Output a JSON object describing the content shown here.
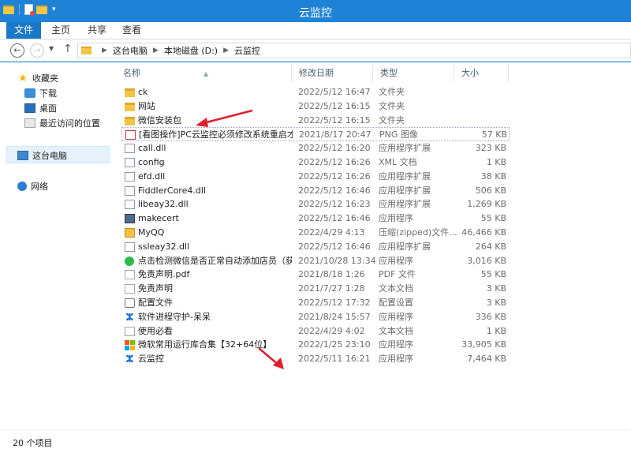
{
  "window": {
    "title": "云监控"
  },
  "ribbon": {
    "tabs": [
      "文件",
      "主页",
      "共享",
      "查看"
    ]
  },
  "address": {
    "crumbs": [
      "这台电脑",
      "本地磁盘 (D:)",
      "云监控"
    ]
  },
  "nav": {
    "favorites": "收藏夹",
    "downloads": "下载",
    "desktop": "桌面",
    "recent": "最近访问的位置",
    "this_pc": "这台电脑",
    "network": "网络"
  },
  "columns": {
    "name": "名称",
    "date": "修改日期",
    "type": "类型",
    "size": "大小"
  },
  "files": [
    {
      "name": "ck",
      "date": "2022/5/12 16:47",
      "type": "文件夹",
      "size": "",
      "icon": "folder-icon"
    },
    {
      "name": "网站",
      "date": "2022/5/12 16:15",
      "type": "文件夹",
      "size": "",
      "icon": "folder-icon"
    },
    {
      "name": "微信安装包",
      "date": "2022/5/12 16:15",
      "type": "文件夹",
      "size": "",
      "icon": "folder-icon"
    },
    {
      "name": "[看图操作]PC云监控必须修改系统重启才...",
      "date": "2021/8/17 20:47",
      "type": "PNG 图像",
      "size": "57 KB",
      "icon": "png-icon"
    },
    {
      "name": "call.dll",
      "date": "2022/5/12 16:20",
      "type": "应用程序扩展",
      "size": "323 KB",
      "icon": "dll-icon"
    },
    {
      "name": "config",
      "date": "2022/5/12 16:26",
      "type": "XML 文档",
      "size": "1 KB",
      "icon": "config-icon"
    },
    {
      "name": "efd.dll",
      "date": "2022/5/12 16:26",
      "type": "应用程序扩展",
      "size": "38 KB",
      "icon": "dll-icon"
    },
    {
      "name": "FiddlerCore4.dll",
      "date": "2022/5/12 16:46",
      "type": "应用程序扩展",
      "size": "506 KB",
      "icon": "dll-icon"
    },
    {
      "name": "libeay32.dll",
      "date": "2022/5/12 16:23",
      "type": "应用程序扩展",
      "size": "1,269 KB",
      "icon": "dll-icon"
    },
    {
      "name": "makecert",
      "date": "2022/5/12 16:46",
      "type": "应用程序",
      "size": "55 KB",
      "icon": "exe-icon"
    },
    {
      "name": "MyQQ",
      "date": "2022/4/29 4:13",
      "type": "压缩(zipped)文件...",
      "size": "46,466 KB",
      "icon": "zip-icon"
    },
    {
      "name": "ssleay32.dll",
      "date": "2022/5/12 16:46",
      "type": "应用程序扩展",
      "size": "264 KB",
      "icon": "dll-icon"
    },
    {
      "name": "点击检测微信是否正常自动添加店员（获...",
      "date": "2021/10/28 13:34",
      "type": "应用程序",
      "size": "3,016 KB",
      "icon": "wechat-icon"
    },
    {
      "name": "免责声明.pdf",
      "date": "2021/8/18 1:26",
      "type": "PDF 文件",
      "size": "55 KB",
      "icon": "document-icon"
    },
    {
      "name": "免责声明",
      "date": "2021/7/27 1:28",
      "type": "文本文档",
      "size": "3 KB",
      "icon": "document-icon"
    },
    {
      "name": "配置文件",
      "date": "2022/5/12 17:32",
      "type": "配置设置",
      "size": "3 KB",
      "icon": "settings-file-icon"
    },
    {
      "name": "软件进程守护-呆呆",
      "date": "2021/8/24 15:57",
      "type": "应用程序",
      "size": "336 KB",
      "icon": "app-blue-icon"
    },
    {
      "name": "使用必看",
      "date": "2022/4/29 4:02",
      "type": "文本文档",
      "size": "1 KB",
      "icon": "document-icon"
    },
    {
      "name": "微软常用运行库合集【32+64位】",
      "date": "2022/1/25 23:10",
      "type": "应用程序",
      "size": "33,905 KB",
      "icon": "microsoft-icon"
    },
    {
      "name": "云监控",
      "date": "2022/5/11 16:21",
      "type": "应用程序",
      "size": "7,464 KB",
      "icon": "app-blue-icon"
    }
  ],
  "status": {
    "item_count": "20 个项目"
  },
  "colors": {
    "titlebar": "#1e82d6",
    "file_tab": "#1a78c9",
    "annotation_arrow": "#e0202a"
  }
}
